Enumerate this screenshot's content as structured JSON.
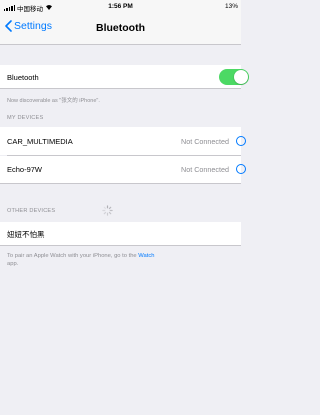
{
  "status_bar": {
    "carrier": "中国移动",
    "time": "1:56 PM",
    "battery": "13%"
  },
  "nav": {
    "back_label": "Settings",
    "title": "Bluetooth"
  },
  "bluetooth": {
    "label": "Bluetooth",
    "enabled": true,
    "discoverable_text": "Now discoverable as \"张文的 iPhone\"."
  },
  "my_devices": {
    "header": "MY DEVICES",
    "items": [
      {
        "name": "CAR_MULTIMEDIA",
        "status": "Not Connected"
      },
      {
        "name": "Echo-97W",
        "status": "Not Connected"
      }
    ]
  },
  "other_devices": {
    "header": "OTHER DEVICES",
    "items": [
      {
        "name": "妞妞不怕黑"
      }
    ]
  },
  "pair_note": {
    "text": "To pair an Apple Watch with your iPhone, go to the ",
    "link": "Watch",
    "text_end": "app."
  },
  "colors": {
    "accent": "#007aff",
    "toggle_on": "#4cd964",
    "secondary_text": "#8e8e93",
    "background": "#efeff4"
  },
  "icons": {
    "signal": "signal-bars-icon",
    "wifi": "wifi-icon",
    "back": "chevron-left-icon",
    "info": "info-circle-icon",
    "spinner": "activity-spinner-icon"
  }
}
